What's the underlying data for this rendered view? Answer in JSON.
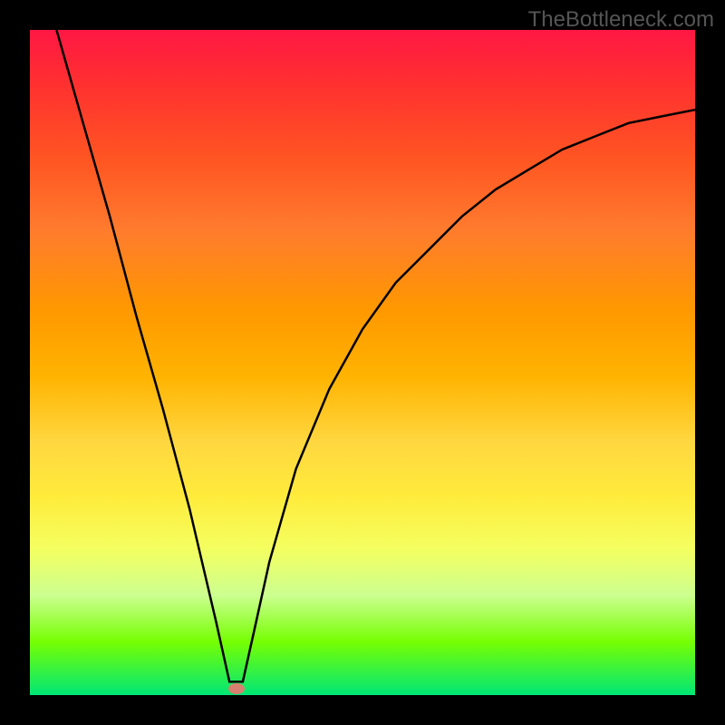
{
  "watermark": "TheBottleneck.com",
  "chart_data": {
    "type": "line",
    "title": "",
    "xlabel": "",
    "ylabel": "",
    "series": [
      {
        "name": "curve",
        "x": [
          0.04,
          0.08,
          0.12,
          0.16,
          0.2,
          0.24,
          0.28,
          0.3,
          0.32,
          0.34,
          0.36,
          0.4,
          0.45,
          0.5,
          0.55,
          0.6,
          0.65,
          0.7,
          0.75,
          0.8,
          0.85,
          0.9,
          0.95,
          1.0
        ],
        "y": [
          1.0,
          0.86,
          0.72,
          0.57,
          0.43,
          0.28,
          0.11,
          0.02,
          0.02,
          0.11,
          0.2,
          0.34,
          0.46,
          0.55,
          0.62,
          0.67,
          0.72,
          0.76,
          0.79,
          0.82,
          0.84,
          0.86,
          0.87,
          0.88
        ]
      }
    ],
    "xlim": [
      0,
      1
    ],
    "ylim": [
      0,
      1
    ],
    "marker": {
      "x": 0.31,
      "y": 0.01
    }
  },
  "colors": {
    "gradient_top": "#ff1744",
    "gradient_bottom": "#00e676",
    "curve": "#000000",
    "marker": "#d88070",
    "frame": "#000000"
  }
}
